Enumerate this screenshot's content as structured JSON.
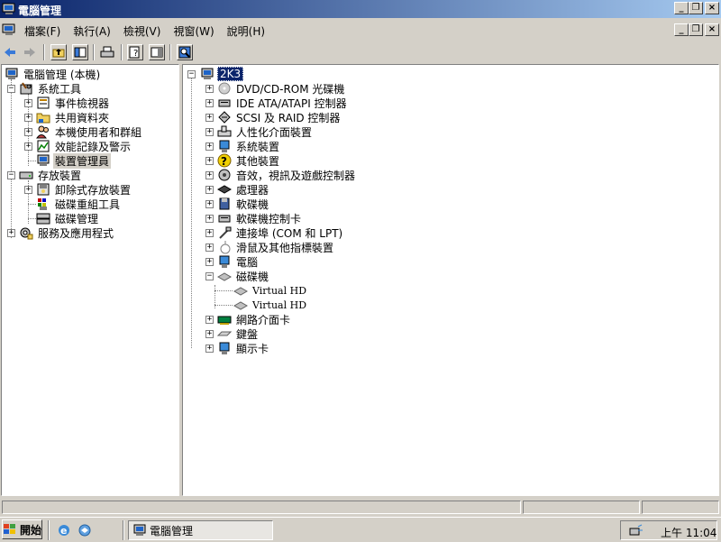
{
  "window": {
    "title": "電腦管理"
  },
  "menu": {
    "items": [
      "檔案(F)",
      "執行(A)",
      "檢視(V)",
      "視窗(W)",
      "說明(H)"
    ]
  },
  "tree": {
    "root": "電腦管理 (本機)",
    "system_tools": "系統工具",
    "event_viewer": "事件檢視器",
    "shared_folders": "共用資料夾",
    "local_users": "本機使用者和群組",
    "perf_logs": "效能記錄及警示",
    "device_manager": "裝置管理員",
    "storage": "存放裝置",
    "removable_storage": "卸除式存放裝置",
    "defrag": "磁碟重組工具",
    "disk_mgmt": "磁碟管理",
    "services_apps": "服務及應用程式"
  },
  "devices": {
    "computer_name": "2K3",
    "categories": [
      "DVD/CD-ROM 光碟機",
      "IDE ATA/ATAPI 控制器",
      "SCSI 及 RAID 控制器",
      "人性化介面裝置",
      "系統裝置",
      "其他裝置",
      "音效，視訊及遊戲控制器",
      "處理器",
      "軟碟機",
      "軟碟機控制卡",
      "連接埠 (COM 和 LPT)",
      "滑鼠及其他指標裝置",
      "電腦",
      "磁碟機",
      "Virtual HD",
      "Virtual HD",
      "網路介面卡",
      "鍵盤",
      "顯示卡"
    ]
  },
  "taskbar": {
    "start_label": "開始",
    "task_label": "電腦管理",
    "clock": "上午 11:04"
  }
}
